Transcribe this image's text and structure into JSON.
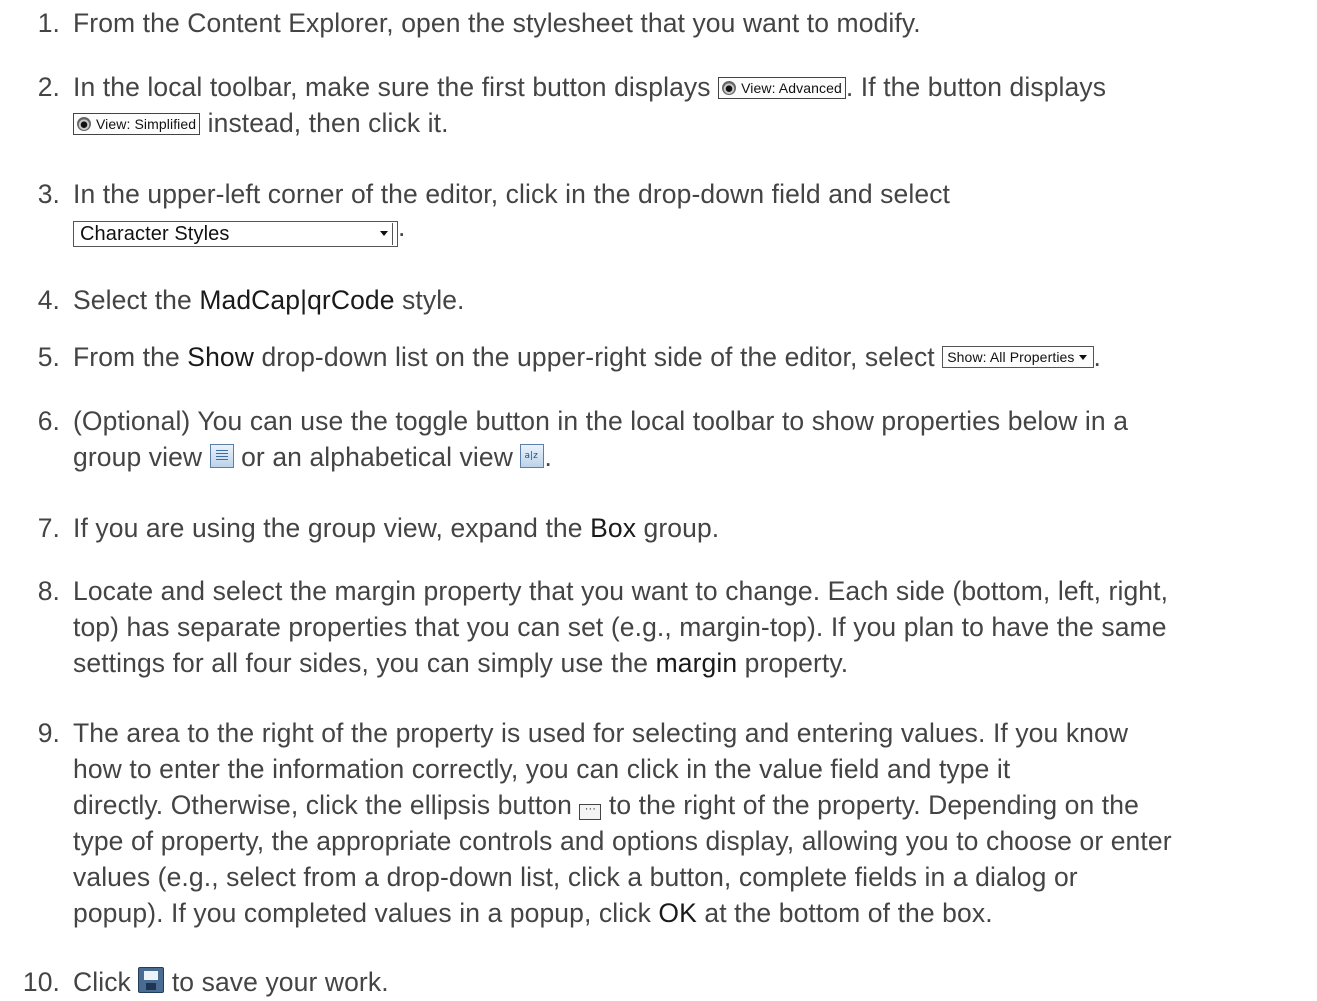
{
  "steps": [
    {
      "num": "1.",
      "text": "From the Content Explorer, open the stylesheet that you want to modify."
    },
    {
      "num": "2.",
      "a": "In the local toolbar, make sure the first button displays ",
      "btn1": "View: Advanced",
      "b": ". If the button displays",
      "btn2": "View: Simplified",
      "c": " instead, then click it."
    },
    {
      "num": "3.",
      "a": "In the upper-left corner of the editor, click in the drop-down field and select",
      "dropdown": "Character Styles",
      "end": "."
    },
    {
      "num": "4.",
      "a": "Select the ",
      "bold": "MadCap|qrCode",
      "b": " style."
    },
    {
      "num": "5.",
      "a": "From the ",
      "bold": "Show",
      "b": " drop-down list on the upper-right side of the editor, select ",
      "btn": "Show: All Properties",
      "end": "."
    },
    {
      "num": "6.",
      "a": "(Optional) You can use the toggle button in the local toolbar to show properties below in a",
      "b": "group view ",
      "c": " or an alphabetical view ",
      "end": ".",
      "icon1": "group-view-icon",
      "icon2": "alphabetical-view-icon"
    },
    {
      "num": "7.",
      "a": "If you are using the group view, expand the ",
      "bold": "Box",
      "b": " group."
    },
    {
      "num": "8.",
      "l1": "Locate and select the margin property that you want to change. Each side (bottom, left, right,",
      "l2": "top) has separate properties that you can set (e.g., margin-top). If you plan to have the same",
      "l3a": "settings for all four sides, you can simply use the ",
      "bold": "margin",
      "l3b": " property."
    },
    {
      "num": "9.",
      "l1": "The area to the right of the property is used for selecting and entering values. If you know",
      "l2": "how to enter the information correctly, you can click in the value field and type it",
      "l3a": "directly. Otherwise, click the ellipsis button ",
      "l3b": " to the right of the property. Depending on the",
      "l4": "type of property, the appropriate controls and options display, allowing you to choose or enter",
      "l5": "values (e.g., select from a drop-down list, click a button, complete fields in a dialog or",
      "l6a": "popup). If you completed values in a popup, click ",
      "bold": "OK",
      "l6b": " at the bottom of the box.",
      "icon": "ellipsis-icon"
    },
    {
      "num": "10.",
      "a": "Click ",
      "b": " to save your work.",
      "icon": "save-icon"
    }
  ]
}
